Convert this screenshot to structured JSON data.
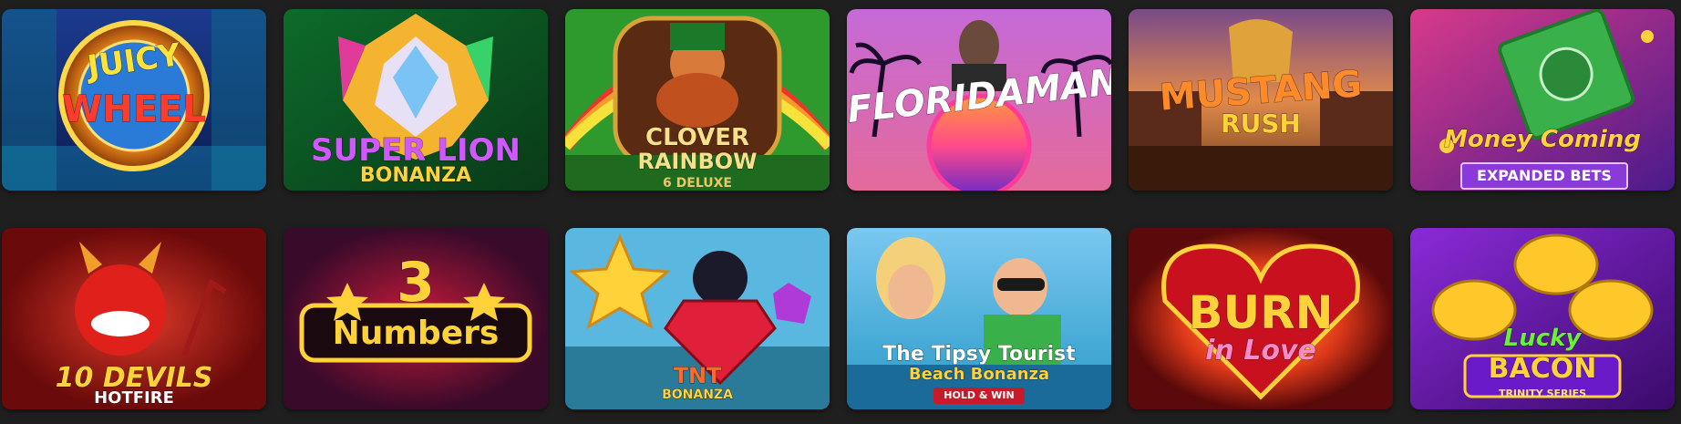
{
  "games": [
    {
      "title_line1": "JUICY",
      "title_line2": "WHEEL",
      "extra": ""
    },
    {
      "title_line1": "SUPER LION",
      "title_line2": "BONANZA",
      "extra": ""
    },
    {
      "title_line1": "CLOVER",
      "title_line2": "RAINBOW",
      "extra": "6 DELUXE"
    },
    {
      "title_line1": "FLORIDAMAN",
      "title_line2": "",
      "extra": ""
    },
    {
      "title_line1": "MUSTANG",
      "title_line2": "RUSH",
      "extra": ""
    },
    {
      "title_line1": "Money Coming",
      "title_line2": "",
      "extra": "EXPANDED BETS"
    },
    {
      "title_line1": "10 DEVILS",
      "title_line2": "HOTFIRE",
      "extra": ""
    },
    {
      "title_line1": "3",
      "title_line2": "Numbers",
      "extra": ""
    },
    {
      "title_line1": "TNT",
      "title_line2": "BONANZA",
      "extra": ""
    },
    {
      "title_line1": "The Tipsy Tourist",
      "title_line2": "Beach Bonanza",
      "extra": "HOLD & WIN"
    },
    {
      "title_line1": "BURN",
      "title_line2": "in Love",
      "extra": ""
    },
    {
      "title_line1": "Lucky",
      "title_line2": "BACON",
      "extra": "TRINITY SERIES"
    }
  ]
}
